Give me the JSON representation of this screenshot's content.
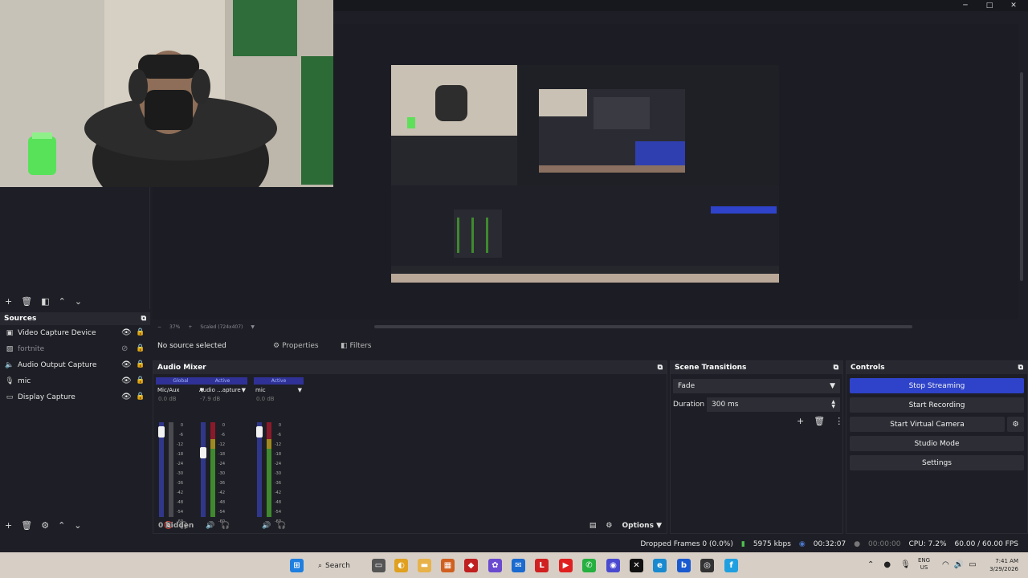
{
  "window": {
    "minimize": "─",
    "maximize": "□",
    "close": "✕"
  },
  "preview": {
    "zoom": "37%",
    "scale_label": "Scaled (724x407)"
  },
  "context_bar": {
    "no_source": "No source selected",
    "properties": "Properties",
    "filters": "Filters"
  },
  "sources": {
    "title": "Sources",
    "items": [
      {
        "label": "Video Capture Device",
        "icon": "camera-icon",
        "visible": true
      },
      {
        "label": "fortnite",
        "icon": "image-icon",
        "visible": false
      },
      {
        "label": "Audio Output Capture",
        "icon": "speaker-icon",
        "visible": true
      },
      {
        "label": "mic",
        "icon": "microphone-icon",
        "visible": true
      },
      {
        "label": "Display Capture",
        "icon": "monitor-icon",
        "visible": true
      }
    ]
  },
  "mixer": {
    "title": "Audio Mixer",
    "hidden": "0 hidden",
    "options": "Options",
    "channels": [
      {
        "tag": "Global",
        "name": "Mic/Aux",
        "db": "0.0 dB",
        "fader": 0.95,
        "muted": true
      },
      {
        "tag": "Active",
        "name": "Audio ...apture",
        "db": "-7.9 dB",
        "fader": 0.7,
        "muted": false
      },
      {
        "tag": "Active",
        "name": "mic",
        "db": "0.0 dB",
        "fader": 0.95,
        "muted": false
      }
    ],
    "ticks": [
      "0",
      "-6",
      "-12",
      "-18",
      "-24",
      "-30",
      "-36",
      "-42",
      "-48",
      "-54",
      "-60"
    ]
  },
  "transitions": {
    "title": "Scene Transitions",
    "selected": "Fade",
    "duration_label": "Duration",
    "duration_value": "300 ms"
  },
  "controls": {
    "title": "Controls",
    "stop_streaming": "Stop Streaming",
    "start_recording": "Start Recording",
    "start_virtual_camera": "Start Virtual Camera",
    "studio_mode": "Studio Mode",
    "settings": "Settings"
  },
  "status": {
    "dropped": "Dropped Frames 0 (0.0%)",
    "bitrate": "5975 kbps",
    "stream_time": "00:32:07",
    "rec_time": "00:00:00",
    "cpu": "CPU: 7.2%",
    "fps": "60.00 / 60.00 FPS"
  },
  "taskbar": {
    "search": "Search",
    "lang1": "ENG",
    "lang2": "US",
    "time": "7:41 AM",
    "date": "3/29/2026"
  },
  "colors": {
    "accent": "#2e43c9",
    "panel": "#1e1f26",
    "meter_green": "#3f8a2e",
    "meter_red": "#8a1a2a"
  }
}
